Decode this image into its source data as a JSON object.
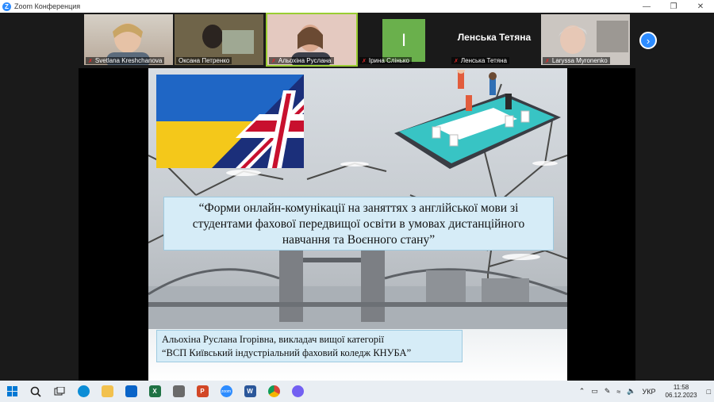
{
  "window": {
    "title": "Zoom Конференция",
    "controls": [
      "minimize-icon",
      "restore-icon",
      "close-icon"
    ]
  },
  "participants": [
    {
      "name": "Svetlana Kreshchanova",
      "muted": true,
      "bg": "#c7bba9"
    },
    {
      "name": "Оксана Петренко",
      "muted": false,
      "bg": "#6b5a4a"
    },
    {
      "name": "Альохіна Руслана",
      "muted": true,
      "bg": "#d9b7a8",
      "active": true
    },
    {
      "name": "Ірина Слінько",
      "muted": true,
      "bg": "#6ab04c",
      "initial": "I"
    },
    {
      "name": "Ленська Тетяна",
      "muted": true,
      "bg": "#1a1a1a",
      "big_label": "Ленська Тетяна"
    },
    {
      "name": "Laryssa Myronenko",
      "muted": true,
      "bg": "#b9b3ad"
    }
  ],
  "slide": {
    "title": "“Форми онлайн-комунікації на заняттях з англійської мови зі студентами фахової передвищої освіти в умовах дистанційного навчання та Воєнного стану”",
    "author_line1": "Альохіна Руслана Ігорівна, викладач вищої категорії",
    "author_line2": "“ВСП Київський індустріальний фаховий коледж КНУБА”"
  },
  "taskbar": {
    "apps": [
      {
        "name": "windows-start-icon",
        "color": "#0078d4"
      },
      {
        "name": "search-icon",
        "color": "#222"
      },
      {
        "name": "task-view-icon",
        "color": "#222"
      },
      {
        "name": "edge-icon",
        "color": "#0c8dd6"
      },
      {
        "name": "file-explorer-icon",
        "color": "#f2c14e"
      },
      {
        "name": "mail-icon",
        "color": "#0a64c8"
      },
      {
        "name": "excel-icon",
        "color": "#1f7244"
      },
      {
        "name": "store-icon",
        "color": "#555"
      },
      {
        "name": "powerpoint-icon",
        "color": "#d24726"
      },
      {
        "name": "zoom-icon",
        "color": "#2d8cff"
      },
      {
        "name": "word-icon",
        "color": "#2b579a"
      },
      {
        "name": "chrome-icon",
        "color": "#db4437"
      },
      {
        "name": "viber-icon",
        "color": "#7360f2"
      }
    ],
    "zoom_label": "zoom",
    "word_label": "W",
    "excel_label": "X",
    "ppt_label": "P",
    "lang": "УКР",
    "time": "11:58",
    "date": "06.12.2023"
  }
}
